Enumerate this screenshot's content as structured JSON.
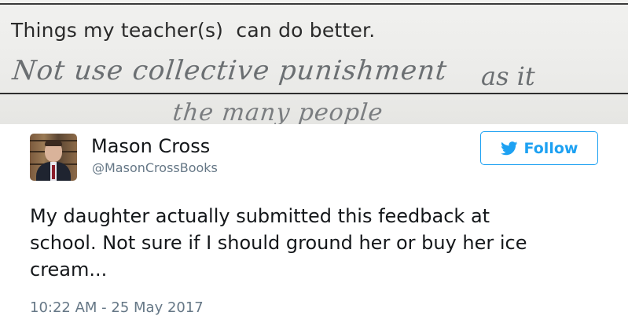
{
  "photo": {
    "prompt": "Things my teacher(s)  can do better.",
    "handwriting_line1": "Not use collective punishment",
    "handwriting_tail": "as it",
    "handwriting_line2": "the many people"
  },
  "tweet": {
    "author_name": "Mason Cross",
    "author_handle": "@MasonCrossBooks",
    "follow_label": "Follow",
    "text_lines": [
      "My daughter actually submitted this feedback at",
      "school. Not sure if I should ground her or buy her ice",
      "cream..."
    ],
    "timestamp": "10:22 AM - 25 May 2017"
  },
  "colors": {
    "twitter_blue": "#1da1f2",
    "text_primary": "#14171a",
    "text_secondary": "#657786"
  },
  "icons": {
    "follow": "twitter-bird-icon"
  }
}
